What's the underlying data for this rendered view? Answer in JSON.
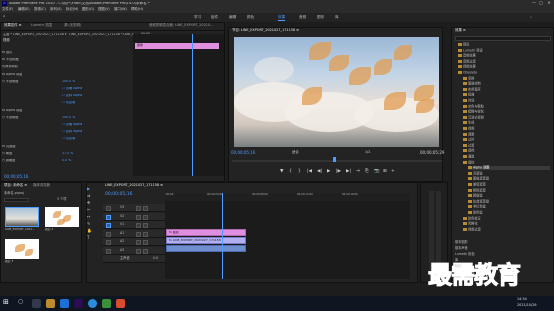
{
  "window": {
    "title": "Adobe Premiere Pro 2020 - C:\\用户\\Yifan\\文档\\Adobe\\Premiere Pro\\14.0\\未命名 *",
    "controls": [
      "—",
      "□",
      "✕"
    ]
  },
  "menu": [
    "文件(F)",
    "编辑(E)",
    "剪辑(C)",
    "序列(S)",
    "标记(M)",
    "图形(G)",
    "视图(V)",
    "窗口(W)",
    "帮助(H)"
  ],
  "workspaces": [
    "学习",
    "组件",
    "编辑",
    "颜色",
    "效果",
    "音频",
    "图形",
    "库"
  ],
  "active_workspace": "效果",
  "effect_controls": {
    "tabs": [
      "效果控件 ≡",
      "Lumetri 范围",
      "源:(无剪辑)",
      "音频剪辑混合器: LINE_EXPORT_20210..."
    ],
    "source_label": "主要 * LINE_EXPORT_2021027_171158 ▾",
    "sequence_label": "LINE_EXPORT_2021027_171158 * LINE_EX...",
    "clip_time": "00:00",
    "clip_label": "图像",
    "section_video": "视频",
    "rows": [
      {
        "label": "fx  运动",
        "value": ""
      },
      {
        "label": "fx  不透明度",
        "value": ""
      },
      {
        "label": "    时间重映射",
        "value": ""
      },
      {
        "label": "fx  Alpha 调整",
        "value": ""
      },
      {
        "label": "    ○ 不透明度",
        "value": "100.0 %"
      },
      {
        "label": "",
        "value": "☐ 忽略 Alpha"
      },
      {
        "label": "",
        "value": "☐ 反转 Alpha"
      },
      {
        "label": "",
        "value": "☐ 仅蒙版"
      },
      {
        "label": "fx  Alpha 调整",
        "value": ""
      },
      {
        "label": "    ○ 不透明度",
        "value": "100.0 %"
      },
      {
        "label": "",
        "value": "☐ 忽略 Alpha"
      },
      {
        "label": "",
        "value": "☐ 反转 Alpha"
      },
      {
        "label": "",
        "value": "☐ 仅蒙版"
      },
      {
        "label": "fx  亮度键",
        "value": ""
      },
      {
        "label": "    ○ 阈值",
        "value": "37.0 %"
      },
      {
        "label": "    ○ 屏蔽度",
        "value": "0.0 %"
      }
    ],
    "timecode": "00;00;05;16"
  },
  "program_monitor": {
    "title": "节目: LINE_EXPORT_2021027_171158 ≡",
    "timecode": "00;00;05;16",
    "fit": "适合",
    "fraction": "1/2",
    "duration": "00;00;05;29",
    "transport": [
      "▼",
      "{",
      "}",
      "|◀",
      "◀|",
      "▶",
      "|▶",
      "▶|",
      "⇥",
      "⎘",
      "📷",
      "⊞",
      "+"
    ]
  },
  "project": {
    "tabs": [
      "项目: 未命名 ≡",
      "媒体浏览器"
    ],
    "filename": "未命名.prproj",
    "items_count": "3 个项",
    "items": [
      {
        "name": "LINE_EXPORT_2021...",
        "dur": "5:29"
      },
      {
        "name": "图层 2",
        "dur": "5:29"
      },
      {
        "name": "图层 3",
        "dur": "5:29"
      }
    ]
  },
  "timeline": {
    "title": "LINE_EXPORT_2021027_171158 ≡",
    "timecode": "00;00;05;16",
    "ruler": [
      ":00;00",
      "00;00;04;00",
      "00;00;08;00",
      "00;00;12;00",
      "00;00;16;00"
    ],
    "tracks": [
      {
        "name": "V3",
        "label": ""
      },
      {
        "name": "V2",
        "label": ""
      },
      {
        "name": "V1",
        "label": ""
      },
      {
        "name": "A1",
        "label": ""
      },
      {
        "name": "A2",
        "label": ""
      },
      {
        "name": "A3",
        "label": ""
      },
      {
        "name": "主声道",
        "label": "0.0"
      }
    ],
    "clips": [
      {
        "track": "V3",
        "label": "fx 图层"
      },
      {
        "track": "V2",
        "label": "fx LINE_EXPORT_2021027_171158"
      },
      {
        "track": "V1",
        "label": ""
      }
    ]
  },
  "effects": {
    "title": "效果 ≡",
    "tree": [
      {
        "label": "预设",
        "sel": false
      },
      {
        "label": "Lumetri 预设",
        "sel": false
      },
      {
        "label": "音频效果",
        "sel": false
      },
      {
        "label": "音频过渡",
        "sel": false
      },
      {
        "label": "视频效果",
        "sel": false
      },
      {
        "label": "Obsolete",
        "sel": false
      },
      {
        "label": "变换",
        "sel": false
      },
      {
        "label": "图像控制",
        "sel": false
      },
      {
        "label": "实用程序",
        "sel": false
      },
      {
        "label": "扭曲",
        "sel": false
      },
      {
        "label": "时间",
        "sel": false
      },
      {
        "label": "杂色与颗粒",
        "sel": false
      },
      {
        "label": "模糊与锐化",
        "sel": false
      },
      {
        "label": "沉浸式视频",
        "sel": false
      },
      {
        "label": "生成",
        "sel": false
      },
      {
        "label": "视频",
        "sel": false
      },
      {
        "label": "调整",
        "sel": false
      },
      {
        "label": "过时",
        "sel": false
      },
      {
        "label": "过渡",
        "sel": false
      },
      {
        "label": "透视",
        "sel": false
      },
      {
        "label": "通道",
        "sel": false
      },
      {
        "label": "键控",
        "sel": false
      },
      {
        "label": "Alpha 调整",
        "sel": true
      },
      {
        "label": "亮度键",
        "sel": false
      },
      {
        "label": "图像遮罩键",
        "sel": false
      },
      {
        "label": "差值遮罩",
        "sel": false
      },
      {
        "label": "移除遮罩",
        "sel": false
      },
      {
        "label": "超级键",
        "sel": false
      },
      {
        "label": "轨道遮罩键",
        "sel": false
      },
      {
        "label": "非红色键",
        "sel": false
      },
      {
        "label": "颜色键",
        "sel": false
      },
      {
        "label": "颜色校正",
        "sel": false
      },
      {
        "label": "风格化",
        "sel": false
      },
      {
        "label": "视频过渡",
        "sel": false
      }
    ],
    "bottom": [
      "基本图形",
      "基本声音",
      "Lumetri 颜色",
      "库",
      "标记"
    ]
  },
  "watermark": "最需教育",
  "clock": {
    "time": "14:54",
    "date": "2021/10/26"
  },
  "colors": {
    "accent": "#4e9cff",
    "pink_clip": "#e190e0",
    "violet_clip": "#b1b0f0"
  }
}
